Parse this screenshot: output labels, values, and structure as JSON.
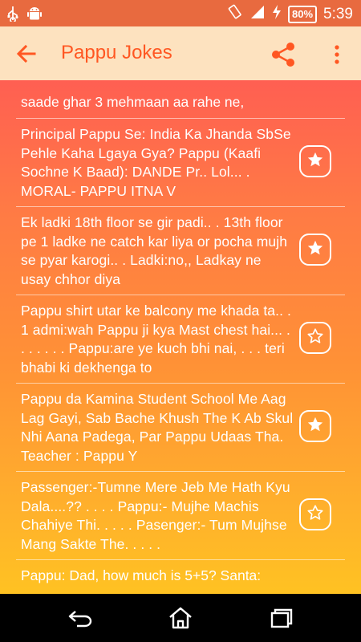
{
  "status_bar": {
    "time": "5:39",
    "battery": "80%",
    "icons": [
      "usb-icon",
      "android-icon",
      "rotate-icon",
      "signal-icon",
      "charging-icon"
    ]
  },
  "app_bar": {
    "title": "Pappu Jokes",
    "back_icon": "arrow-back-icon",
    "share_icon": "share-icon",
    "menu_icon": "more-vert-icon",
    "accent_color": "#ff5722"
  },
  "jokes": {
    "first": "saade ghar 3 mehmaan aa rahe ne,",
    "items": [
      {
        "text": "Principal Pappu Se: India Ka Jhanda SbSe Pehle Kaha Lgaya Gya? Pappu (Kaafi Sochne K Baad): DANDE Pr.. Lol... . MORAL- PAPPU ITNA V",
        "favorite": true
      },
      {
        "text": "Ek ladki 18th floor se gir padi.. . 13th floor pe 1 ladke ne catch kar liya or pocha mujh se pyar karogi.. . Ladki:no,, Ladkay ne usay chhor diya",
        "favorite": true
      },
      {
        "text": "Pappu shirt utar ke balcony me khada ta.. . 1 admi:wah Pappu ji kya Mast chest hai... . . . . . . . Pappu:are ye kuch bhi nai, . . . teri bhabi ki dekhenga to",
        "favorite": false
      },
      {
        "text": "Pappu da Kamina Student School Me Aag Lag Gayi, Sab Bache Khush The K Ab Skul Nhi Aana Padega, Par Pappu Udaas Tha. Teacher : Pappu Y",
        "favorite": true
      },
      {
        "text": "Passenger:-Tumne Mere Jeb Me Hath Kyu Dala....?? . . . . Pappu:- Mujhe Machis Chahiye Thi. . . . . Pasenger:- Tum Mujhse Mang Sakte The. . . . .",
        "favorite": false
      }
    ],
    "partial": "Pappu: Dad, how much is 5+5? Santa:"
  },
  "nav_bar": {
    "back": "nav-back-icon",
    "home": "nav-home-icon",
    "recents": "nav-recents-icon"
  }
}
